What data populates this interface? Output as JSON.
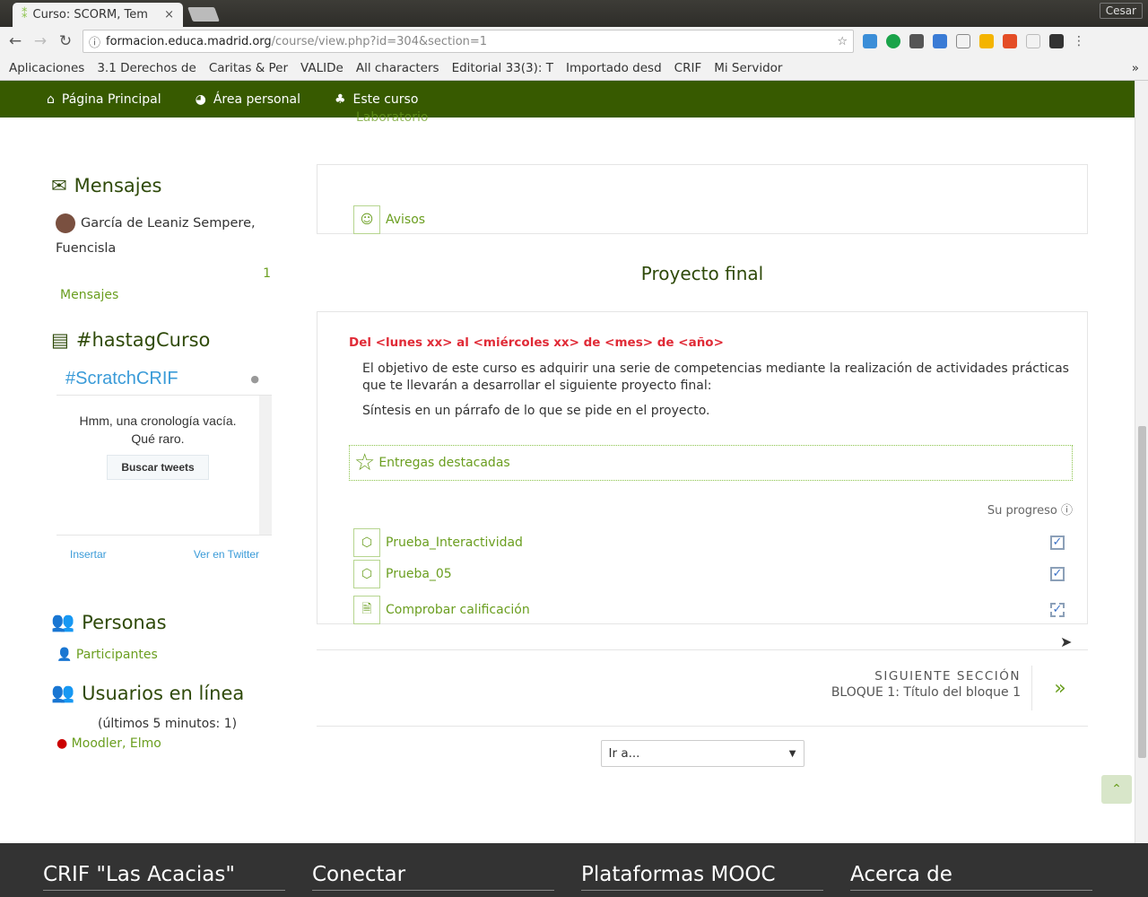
{
  "browser": {
    "tab_title": "Curso: SCORM, Tem",
    "user": "Cesar",
    "url_host": "formacion.educa.madrid.org",
    "url_path": "/course/view.php?id=304&section=1",
    "bookmarks": [
      "Aplicaciones",
      "3.1 Derechos de",
      "Caritas & Per",
      "VALIDe",
      "All characters",
      "Editorial 33(3): T",
      "Importado desd",
      "CRIF",
      "Mi Servidor"
    ]
  },
  "nav": {
    "items": [
      "Página Principal",
      "Área personal",
      "Este curso"
    ]
  },
  "sidebar": {
    "mensajes": {
      "title": "Mensajes",
      "sender": "García de Leaniz Sempere, Fuencisla",
      "count": "1",
      "link": "Mensajes"
    },
    "hashtag": {
      "title": "#hastagCurso",
      "widget_title": "#ScratchCRIF",
      "empty_line1": "Hmm, una cronología vacía.",
      "empty_line2": "Qué raro.",
      "search_button": "Buscar tweets",
      "embed": "Insertar",
      "view_twitter": "Ver en Twitter"
    },
    "personas": {
      "title": "Personas",
      "participants": "Participantes"
    },
    "online": {
      "title": "Usuarios en línea",
      "subtitle": "(últimos 5 minutos: 1)",
      "user": "Moodler, Elmo"
    }
  },
  "main": {
    "partial_top": "Laboratorio",
    "avisos": "Avisos",
    "section_title": "Proyecto final",
    "date": "Del <lunes xx> al <miércoles xx> de <mes> de <año>",
    "para1": "El objetivo de este curso es adquirir una serie de competencias mediante la realización de actividades prácticas que te llevarán a desarrollar el siguiente proyecto final:",
    "para2": "Síntesis en un párrafo de lo que se pide en el proyecto.",
    "featured": "Entregas destacadas",
    "progress_label": "Su progreso",
    "activities": [
      {
        "name": "Prueba_Interactividad",
        "completed": true
      },
      {
        "name": "Prueba_05",
        "completed": true
      },
      {
        "name": "Comprobar calificación",
        "completed": true
      }
    ],
    "next_label": "SIGUIENTE SECCIÓN",
    "next_title": "BLOQUE 1: Título del bloque 1",
    "jump": "Ir a..."
  },
  "footer": {
    "cols": [
      "CRIF \"Las Acacias\"",
      "Conectar",
      "Plataformas MOOC",
      "Acerca de"
    ]
  }
}
